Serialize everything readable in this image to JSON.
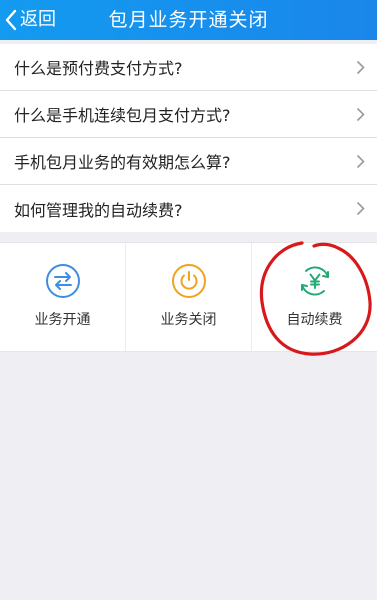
{
  "header": {
    "back_label": "返回",
    "title": "包月业务开通关闭"
  },
  "faq": {
    "items": [
      {
        "label": "什么是预付费支付方式?"
      },
      {
        "label": "什么是手机连续包月支付方式?"
      },
      {
        "label": "手机包月业务的有效期怎么算?"
      },
      {
        "label": "如何管理我的自动续费?"
      }
    ]
  },
  "actions": {
    "items": [
      {
        "label": "业务开通",
        "icon": "transfer-arrows-icon",
        "color": "#3d8de2"
      },
      {
        "label": "业务关闭",
        "icon": "power-icon",
        "color": "#f0a31b"
      },
      {
        "label": "自动续费",
        "icon": "yen-renew-icon",
        "color": "#22a872"
      }
    ]
  },
  "colors": {
    "header": "#1a8fee",
    "annotation": "#d8191c",
    "background": "#eeeef3"
  }
}
